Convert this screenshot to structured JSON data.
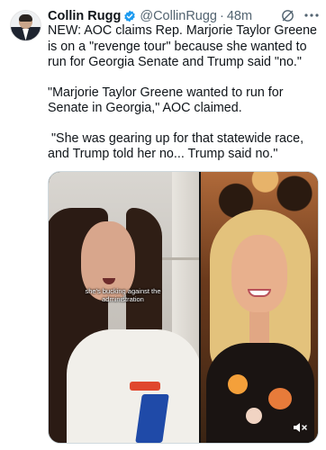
{
  "author": {
    "name": "Collin Rugg",
    "handle": "@CollinRugg",
    "time": "48m",
    "separator": "·"
  },
  "tweet": {
    "paragraphs": [
      "NEW: AOC claims Rep. Marjorie Taylor Greene is on a \"revenge tour\" because she wanted to run for Georgia Senate and Trump said \"no.\"",
      "\"Marjorie Taylor Greene wanted to run for Senate in Georgia,\" AOC claimed.",
      " \"She was gearing up for that statewide race, and Trump told her no... Trump said no.\""
    ]
  },
  "media": {
    "caption": "she's bucking against the administration"
  },
  "icons": {
    "verified": "verified-badge-icon",
    "grok": "grok-icon",
    "more": "more-options-icon",
    "mute": "muted-speaker-icon"
  },
  "colors": {
    "verified_blue": "#1d9bf0",
    "secondary_text": "#536471"
  }
}
